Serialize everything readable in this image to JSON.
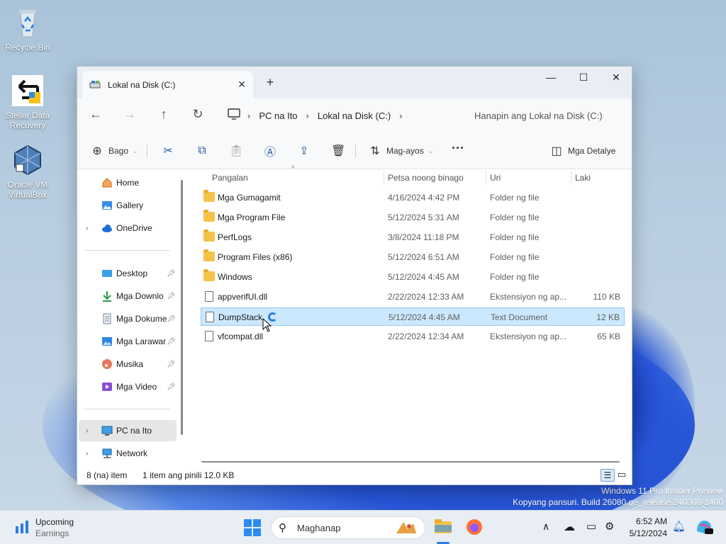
{
  "desktop": {
    "icons": [
      {
        "label": "Recycle Bin"
      },
      {
        "label": "Stellar Data Recovery"
      },
      {
        "label": "Oracle VM VirtualBox"
      }
    ],
    "watermark_line1": "Windows 11 Pro Insider Preview",
    "watermark_line2": "Kopyang pansuri. Build 26080.ge_release.240308-1400"
  },
  "window": {
    "tab_title": "Lokal na Disk (C:)",
    "breadcrumb": [
      "PC na Ito",
      "Lokal na Disk (C:)"
    ],
    "search_placeholder": "Hanapin ang Lokal na Disk (C:)",
    "toolbar": {
      "new_label": "Bago",
      "sort_label": "Mag-ayos",
      "details_label": "Mga Detalye"
    },
    "nav_pane": {
      "home": "Home",
      "gallery": "Gallery",
      "onedrive": "OneDrive",
      "desktop": "Desktop",
      "downloads": "Mga Downlo",
      "documents": "Mga Dokume",
      "pictures": "Mga Larawar",
      "music": "Musika",
      "videos": "Mga Video",
      "thispc": "PC na Ito",
      "network": "Network"
    },
    "columns": {
      "name": "Pangalan",
      "date": "Petsa noong binago",
      "type": "Uri",
      "size": "Laki"
    },
    "files": [
      {
        "name": "Mga Gumagamit",
        "date": "4/16/2024 4:42 PM",
        "type": "Folder ng file",
        "size": "",
        "kind": "folder"
      },
      {
        "name": "Mga Program File",
        "date": "5/12/2024 5:31 AM",
        "type": "Folder ng file",
        "size": "",
        "kind": "folder"
      },
      {
        "name": "PerfLogs",
        "date": "3/8/2024 11:18 PM",
        "type": "Folder ng file",
        "size": "",
        "kind": "folder"
      },
      {
        "name": "Program Files (x86)",
        "date": "5/12/2024 6:51 AM",
        "type": "Folder ng file",
        "size": "",
        "kind": "folder"
      },
      {
        "name": "Windows",
        "date": "5/12/2024 4:45 AM",
        "type": "Folder ng file",
        "size": "",
        "kind": "folder"
      },
      {
        "name": "appverifUI.dll",
        "date": "2/22/2024 12:33 AM",
        "type": "Ekstensiyon ng ap...",
        "size": "110 KB",
        "kind": "file"
      },
      {
        "name": "DumpStack",
        "date": "5/12/2024 4:45 AM",
        "type": "Text Document",
        "size": "12 KB",
        "kind": "file"
      },
      {
        "name": "vfcompat.dll",
        "date": "2/22/2024 12:34 AM",
        "type": "Ekstensiyon ng ap...",
        "size": "65 KB",
        "kind": "file"
      }
    ],
    "status": {
      "count": "8 (na) item",
      "selection": "1 item ang pinili  12.0 KB"
    }
  },
  "taskbar": {
    "widget_title": "Upcoming",
    "widget_sub": "Earnings",
    "search_placeholder": "Maghanap",
    "time": "6:52 AM",
    "date": "5/12/2024"
  }
}
